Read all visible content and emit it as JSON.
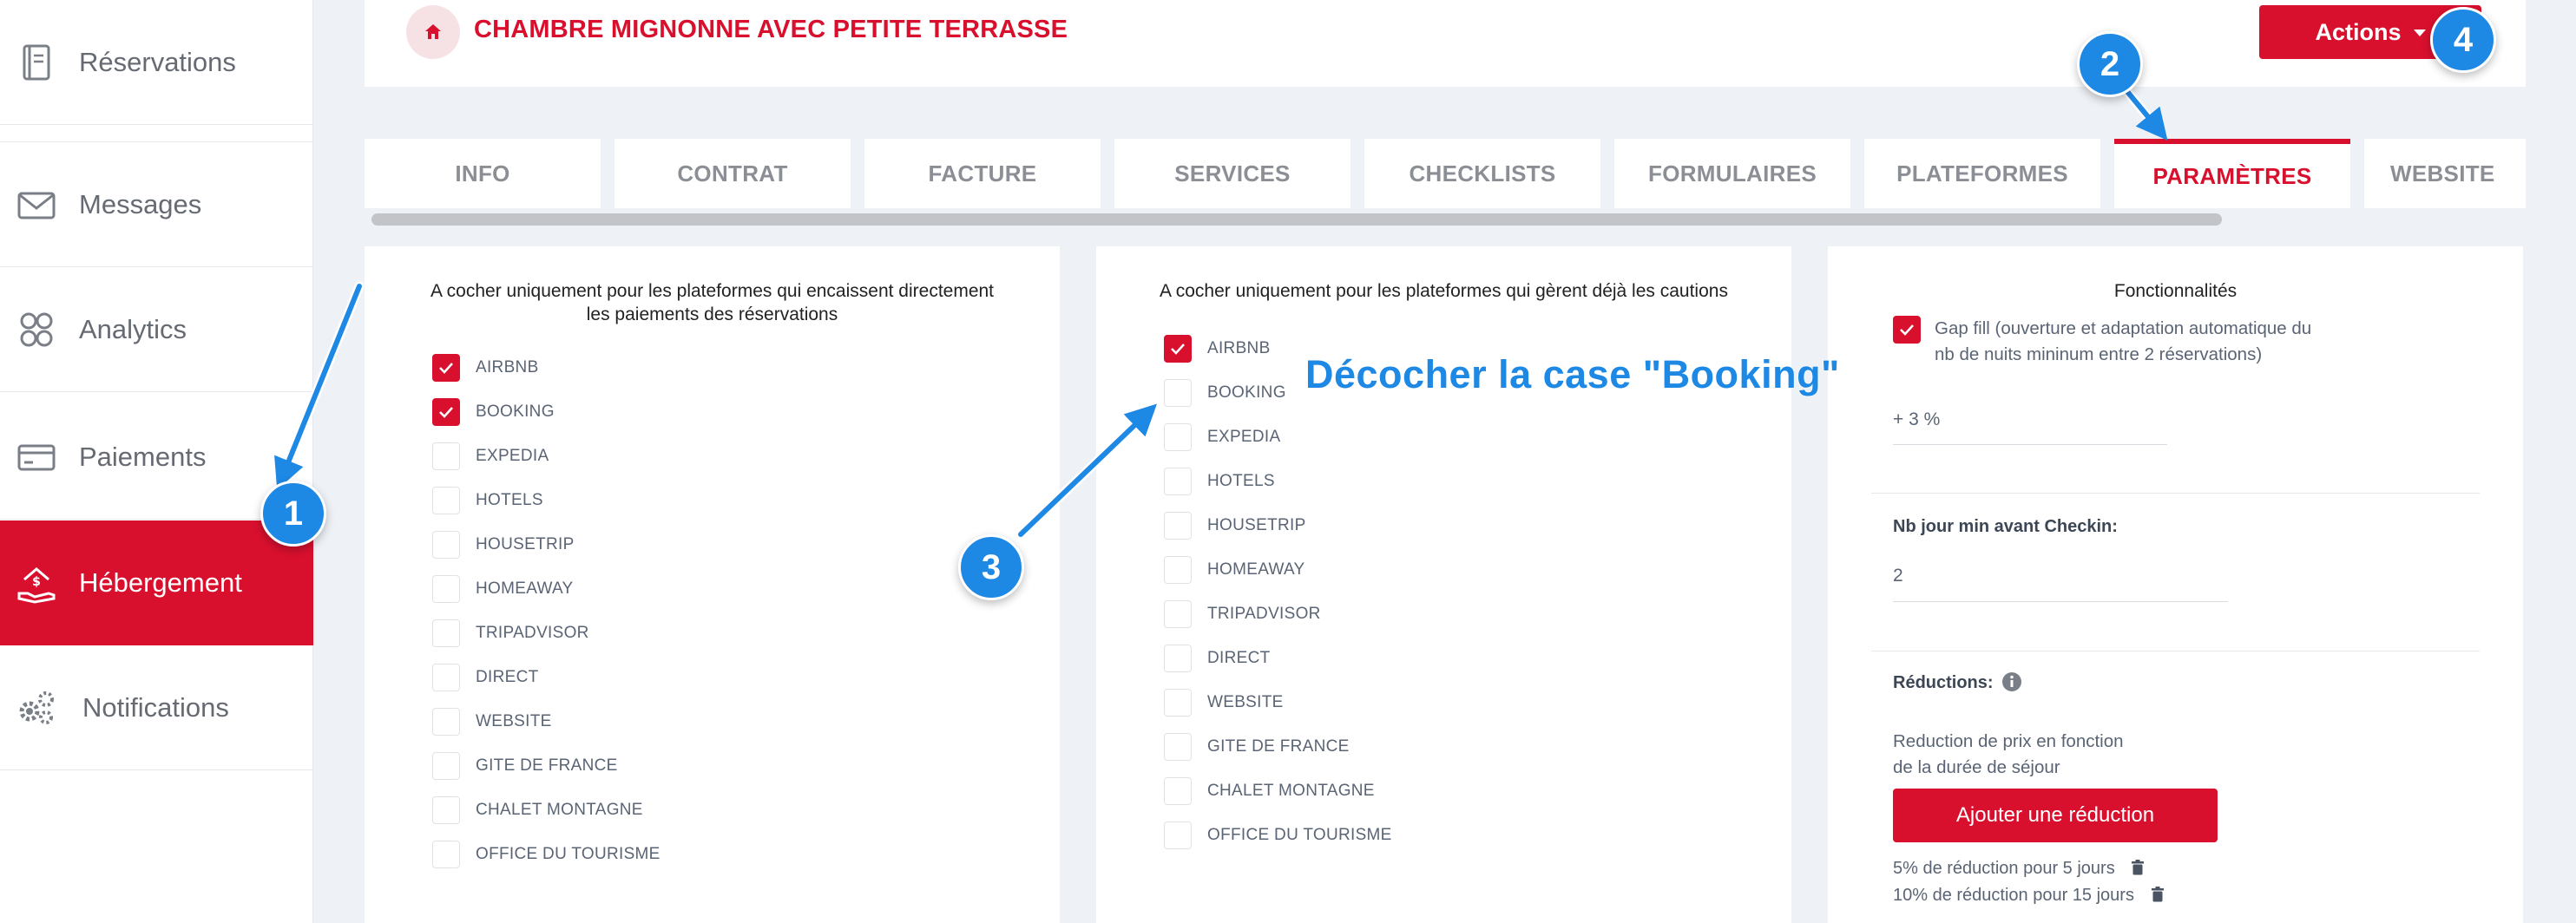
{
  "sidebar": {
    "items": [
      {
        "label": "Réservations",
        "icon": "reservations-book-icon",
        "active": false
      },
      {
        "label": "Messages",
        "icon": "envelope-icon",
        "active": false
      },
      {
        "label": "Analytics",
        "icon": "analytics-icon",
        "active": false
      },
      {
        "label": "Paiements",
        "icon": "credit-card-icon",
        "active": false
      },
      {
        "label": "Hébergement",
        "icon": "house-hand-icon",
        "active": true
      },
      {
        "label": "Notifications",
        "icon": "gears-icon",
        "active": false
      }
    ]
  },
  "header": {
    "title": "CHAMBRE MIGNONNE AVEC PETITE TERRASSE",
    "home_icon": "home-icon",
    "actions_label": "Actions"
  },
  "tabs": [
    {
      "label": "INFO",
      "active": false
    },
    {
      "label": "CONTRAT",
      "active": false
    },
    {
      "label": "FACTURE",
      "active": false
    },
    {
      "label": "SERVICES",
      "active": false
    },
    {
      "label": "CHECKLISTS",
      "active": false
    },
    {
      "label": "FORMULAIRES",
      "active": false
    },
    {
      "label": "PLATEFORMES",
      "active": false
    },
    {
      "label": "PARAMÈTRES",
      "active": true
    },
    {
      "label": "WEBSITE",
      "active": false
    }
  ],
  "payments_panel": {
    "title": "A cocher uniquement pour les plateformes qui encaissent directement les paiements des réservations",
    "title_line1": "A cocher uniquement pour les plateformes qui encaissent directement",
    "title_line2": "les paiements des réservations",
    "platforms": [
      {
        "label": "AIRBNB",
        "checked": true
      },
      {
        "label": "BOOKING",
        "checked": true
      },
      {
        "label": "EXPEDIA",
        "checked": false
      },
      {
        "label": "HOTELS",
        "checked": false
      },
      {
        "label": "HOUSETRIP",
        "checked": false
      },
      {
        "label": "HOMEAWAY",
        "checked": false
      },
      {
        "label": "TRIPADVISOR",
        "checked": false
      },
      {
        "label": "DIRECT",
        "checked": false
      },
      {
        "label": "WEBSITE",
        "checked": false
      },
      {
        "label": "GITE DE FRANCE",
        "checked": false
      },
      {
        "label": "CHALET MONTAGNE",
        "checked": false
      },
      {
        "label": "OFFICE DU TOURISME",
        "checked": false
      }
    ]
  },
  "deposits_panel": {
    "title": "A cocher uniquement pour les plateformes qui gèrent déjà les cautions",
    "platforms": [
      {
        "label": "AIRBNB",
        "checked": true
      },
      {
        "label": "BOOKING",
        "checked": false
      },
      {
        "label": "EXPEDIA",
        "checked": false
      },
      {
        "label": "HOTELS",
        "checked": false
      },
      {
        "label": "HOUSETRIP",
        "checked": false
      },
      {
        "label": "HOMEAWAY",
        "checked": false
      },
      {
        "label": "TRIPADVISOR",
        "checked": false
      },
      {
        "label": "DIRECT",
        "checked": false
      },
      {
        "label": "WEBSITE",
        "checked": false
      },
      {
        "label": "GITE DE FRANCE",
        "checked": false
      },
      {
        "label": "CHALET MONTAGNE",
        "checked": false
      },
      {
        "label": "OFFICE DU TOURISME",
        "checked": false
      }
    ]
  },
  "features_panel": {
    "title": "Fonctionnalités",
    "gap_fill_label": "Gap fill (ouverture et adaptation automatique du nb de nuits mininum entre 2 réservations)",
    "gap_fill_line1": "Gap fill (ouverture et adaptation automatique du",
    "gap_fill_line2": "nb de nuits mininum entre 2 réservations)",
    "gap_fill_checked": true,
    "percent_value": "+ 3 %",
    "min_days_label": "Nb jour min avant Checkin:",
    "min_days_value": "2",
    "reductions_label": "Réductions:",
    "reduction_desc_line1": "Reduction de prix en fonction",
    "reduction_desc_line2": "de la durée de séjour",
    "add_reduction_label": "Ajouter une réduction",
    "reductions": [
      {
        "label": "5% de réduction pour 5 jours"
      },
      {
        "label": "10% de réduction pour 15 jours"
      }
    ]
  },
  "annotations": {
    "badges": [
      "1",
      "2",
      "3",
      "4"
    ],
    "instruction": "Décocher la case \"Booking\""
  },
  "colors": {
    "accent": "#d8102e",
    "annotation_blue": "#1e88e5",
    "background": "#eef1f6"
  }
}
